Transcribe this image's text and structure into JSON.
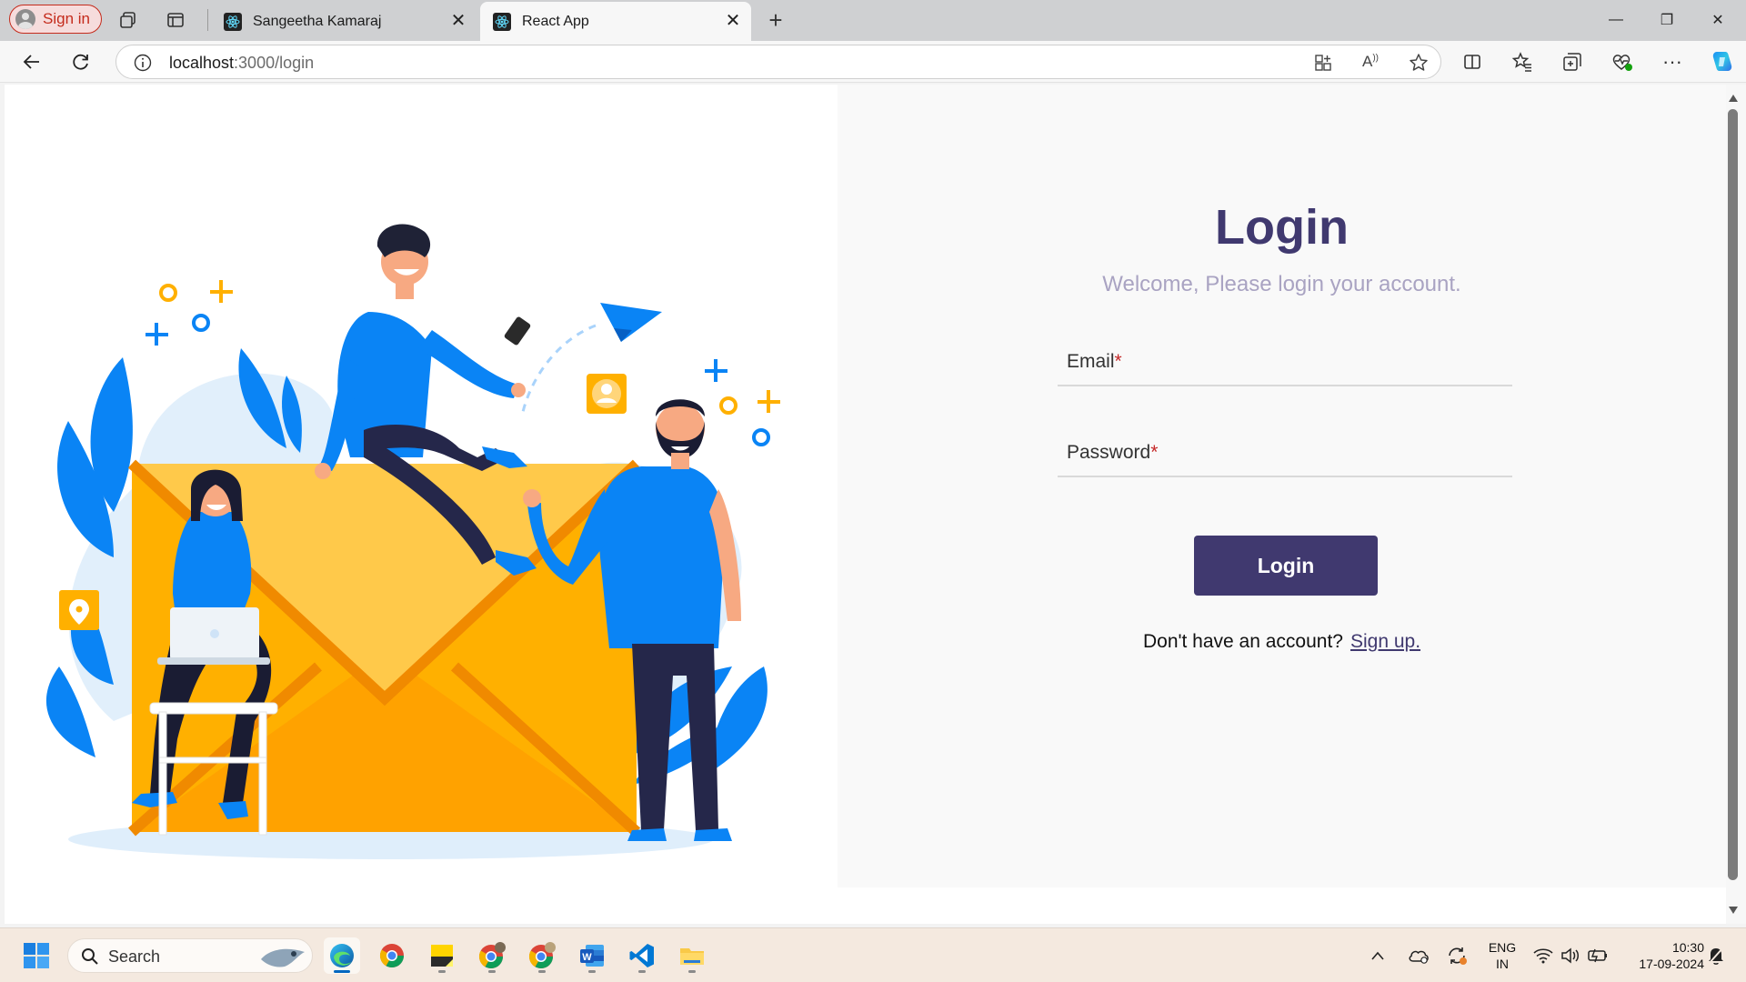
{
  "browser": {
    "profile_label": "Sign in",
    "tabs": [
      {
        "title": "Sangeetha Kamaraj",
        "close": "✕"
      },
      {
        "title": "React App",
        "close": "✕"
      }
    ],
    "new_tab": "+",
    "window_controls": {
      "minimize": "—",
      "restore": "❐",
      "close": "✕"
    },
    "url_host": "localhost",
    "url_path": ":3000/login",
    "toolbar_icons": [
      "back-icon",
      "refresh-icon",
      "site-info-icon",
      "app-available-icon",
      "read-aloud-icon",
      "favorite-star-icon",
      "split-screen-icon",
      "favorites-icon",
      "collections-icon",
      "browser-essentials-icon",
      "more-icon",
      "copilot-icon"
    ]
  },
  "page": {
    "title": "Login",
    "subtitle": "Welcome, Please login your account.",
    "email": {
      "label": "Email",
      "required": "*",
      "value": ""
    },
    "password": {
      "label": "Password",
      "required": "*",
      "value": ""
    },
    "submit_label": "Login",
    "signup_prompt": "Don't have an account?",
    "signup_link": "Sign up.",
    "colors": {
      "primary": "#40396f",
      "subtitle": "#a9a3c2",
      "required": "#c52828",
      "illustration_blue": "#0a84f5",
      "illustration_yellow": "#ffb000"
    }
  },
  "taskbar": {
    "search_placeholder": "Search",
    "apps": [
      "windows-start-icon",
      "edge-icon",
      "chrome-icon",
      "sticky-notes-icon",
      "chrome-profile-icon",
      "chrome-profile-2-icon",
      "word-icon",
      "vscode-icon",
      "file-explorer-icon"
    ],
    "language_line1": "ENG",
    "language_line2": "IN",
    "time": "10:30",
    "date": "17-09-2024"
  }
}
